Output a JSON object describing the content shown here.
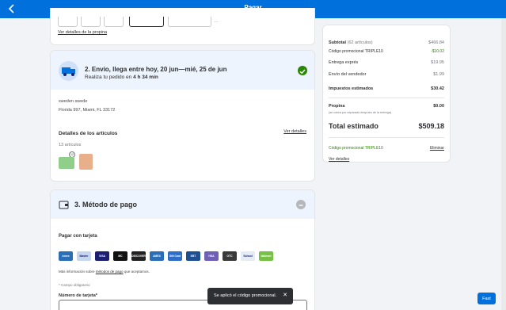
{
  "header": {
    "title": "Pagar"
  },
  "item_section": {
    "view_details": "Ver detalles de la propina",
    "chip_suffix": "..."
  },
  "delivery": {
    "title": "2. Envío, llega entre hoy, 20 jun—mié, 25 de jun",
    "subtitle_prefix": "Realiza tu pedido en ",
    "subtitle_time": "4 h 34 min",
    "name": "sweden swede",
    "address": "Florida 997, Miami, FL 33172",
    "details_title": "Detalles de los artículos",
    "details_link": "Ver detalles",
    "count": "13 artículos",
    "badge": "12"
  },
  "payment": {
    "title": "3. Método de pago",
    "subtitle": "Pagar con tarjeta",
    "cards": [
      {
        "name": "Amex",
        "color": "#2a6fb5"
      },
      {
        "name": "Master",
        "color": "#c7d6ef"
      },
      {
        "name": "VISA",
        "color": "#1a1f71"
      },
      {
        "name": "MC",
        "color": "#111111"
      },
      {
        "name": "DISCOVER",
        "color": "#222222"
      },
      {
        "name": "AMEX",
        "color": "#2a6fb5"
      },
      {
        "name": "Gift Card",
        "color": "#2f6ec6"
      },
      {
        "name": "EBT",
        "color": "#1d4f91"
      },
      {
        "name": "HSA",
        "color": "#6f5fb5"
      },
      {
        "name": "OTC",
        "color": "#3a3a3a"
      },
      {
        "name": "School",
        "color": "#e6ecf5"
      },
      {
        "name": "Walmart",
        "color": "#76c043"
      }
    ],
    "info_prefix": "Más información sobre ",
    "info_link": "métodos de pago",
    "info_suffix": " que aceptamos.",
    "required": "* Campo obligatorio",
    "card_number_label": "Número de tarjeta*"
  },
  "summary": {
    "subtotal_label": "Subtotal",
    "subtotal_count": "(62 artículos)",
    "subtotal": "$466.84",
    "promo_label": "Código promocional TRIPLE10",
    "promo": "-$10.02",
    "express_label": "Entrega exprés",
    "express": "$19.95",
    "seller_label": "Envío del vendedor",
    "seller": "$1.99",
    "taxes_label": "Impuestos estimados",
    "taxes": "$30.42",
    "tip_label": "Propina",
    "tip": "$0.00",
    "tip_note": "(se cobra por separado después de la entrega)",
    "total_label": "Total estimado",
    "total": "$509.18",
    "promo_applied": "Código promocional TRIPLE10",
    "remove": "Eliminar",
    "view_details": "Ver detalles"
  },
  "toast": {
    "message": "Se aplicó el código promocional.",
    "close": "✕"
  },
  "fab": {
    "label": "Fast"
  }
}
